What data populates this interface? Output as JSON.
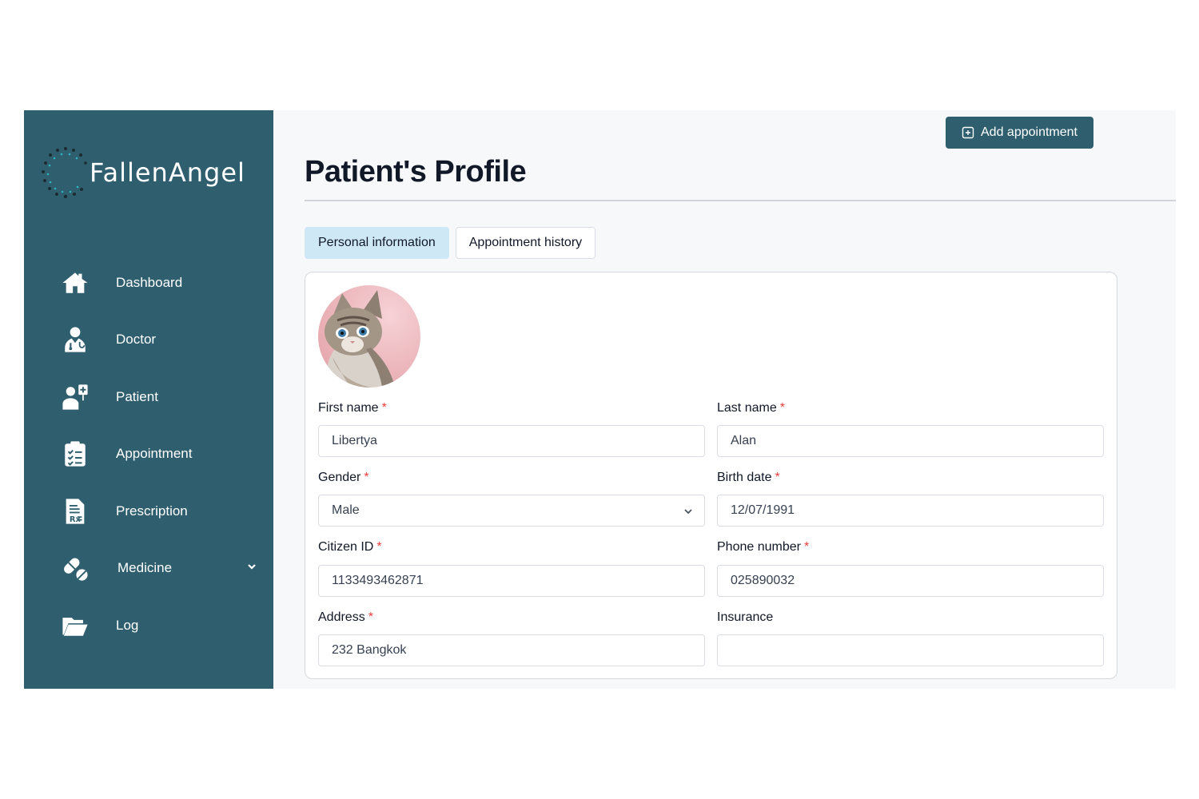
{
  "app": {
    "brand": "FallenAngel"
  },
  "sidebar": {
    "items": [
      {
        "label": "Dashboard",
        "icon": "home-icon"
      },
      {
        "label": "Doctor",
        "icon": "doctor-icon"
      },
      {
        "label": "Patient",
        "icon": "patient-icon"
      },
      {
        "label": "Appointment",
        "icon": "clipboard-icon"
      },
      {
        "label": "Prescription",
        "icon": "prescription-icon"
      },
      {
        "label": "Medicine",
        "icon": "pills-icon",
        "has_submenu": true
      },
      {
        "label": "Log",
        "icon": "folder-open-icon"
      }
    ]
  },
  "page": {
    "title": "Patient's Profile",
    "tabs": [
      {
        "label": "Personal information",
        "active": true
      },
      {
        "label": "Appointment history",
        "active": false
      }
    ],
    "add_button_label": "Add appointment"
  },
  "form": {
    "first_name": {
      "label": "First name",
      "required": "*",
      "value": "Libertya"
    },
    "last_name": {
      "label": "Last name",
      "required": "*",
      "value": "Alan"
    },
    "gender": {
      "label": "Gender",
      "required": "*",
      "value": "Male"
    },
    "birth_date": {
      "label": "Birth date",
      "required": "*",
      "value": "12/07/1991"
    },
    "citizen_id": {
      "label": "Citizen ID",
      "required": "*",
      "value": "1133493462871"
    },
    "phone": {
      "label": "Phone number",
      "required": "*",
      "value": "025890032"
    },
    "address": {
      "label": "Address",
      "required": "*",
      "value": "232 Bangkok"
    },
    "insurance": {
      "label": "Insurance",
      "value": ""
    }
  },
  "colors": {
    "sidebar_bg": "#2f5f6f",
    "active_tab_bg": "#cfe8f6",
    "required_mark": "#e53e3e",
    "primary_button": "#2f5f6f"
  }
}
